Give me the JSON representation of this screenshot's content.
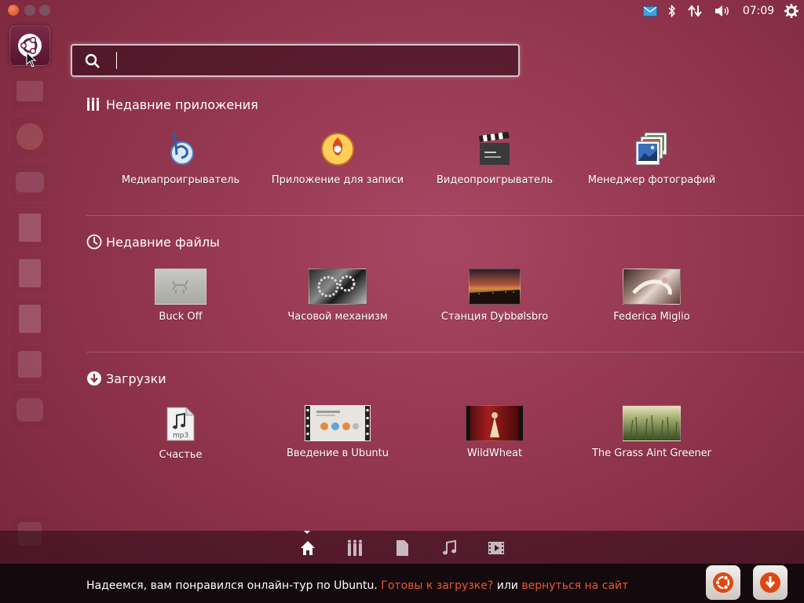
{
  "top_panel": {
    "clock": "07:09",
    "icons": [
      "close-icon",
      "minimize-icon",
      "maximize-icon",
      "mail-icon",
      "bluetooth-icon",
      "network-icon",
      "volume-icon",
      "gear-icon"
    ]
  },
  "launcher": {
    "items": [
      "ubuntu-home",
      "files",
      "firefox",
      "thunderbird",
      "writer",
      "impress",
      "calc",
      "ubuntu-one",
      "workspace",
      "trash"
    ]
  },
  "search": {
    "value": "",
    "placeholder": ""
  },
  "sections": [
    {
      "title": "Недавние приложения",
      "icon": "apps-icon",
      "items": [
        {
          "label": "Медиапроигрыватель",
          "icon": "banshee-icon"
        },
        {
          "label": "Приложение для записи",
          "icon": "brasero-icon"
        },
        {
          "label": "Видеопроигрыватель",
          "icon": "clapperboard-icon"
        },
        {
          "label": "Менеджер фотографий",
          "icon": "photos-icon"
        }
      ]
    },
    {
      "title": "Недавние файлы",
      "icon": "clock-icon",
      "items": [
        {
          "label": "Buck Off"
        },
        {
          "label": "Часовой механизм"
        },
        {
          "label": "Станция Dybbølsbro"
        },
        {
          "label": "Federica Miglio"
        }
      ]
    },
    {
      "title": "Загрузки",
      "icon": "download-icon",
      "items": [
        {
          "label": "Счастье",
          "icon": "mp3-file-icon"
        },
        {
          "label": "Введение в Ubuntu"
        },
        {
          "label": "WildWheat"
        },
        {
          "label": "The Grass Aint Greener"
        }
      ]
    }
  ],
  "lens_bar": {
    "lenses": [
      "home-lens",
      "applications-lens",
      "files-lens",
      "music-lens",
      "video-lens"
    ],
    "active": "home-lens"
  },
  "banner": {
    "text": "Надеемся, вам понравился онлайн-тур по Ubuntu.",
    "link1": "Готовы к загрузке?",
    "or": "или",
    "link2": "вернуться на сайт"
  },
  "colors": {
    "accent": "#e65a2c",
    "background": "#93364f",
    "banner_bg": "#14090d"
  }
}
